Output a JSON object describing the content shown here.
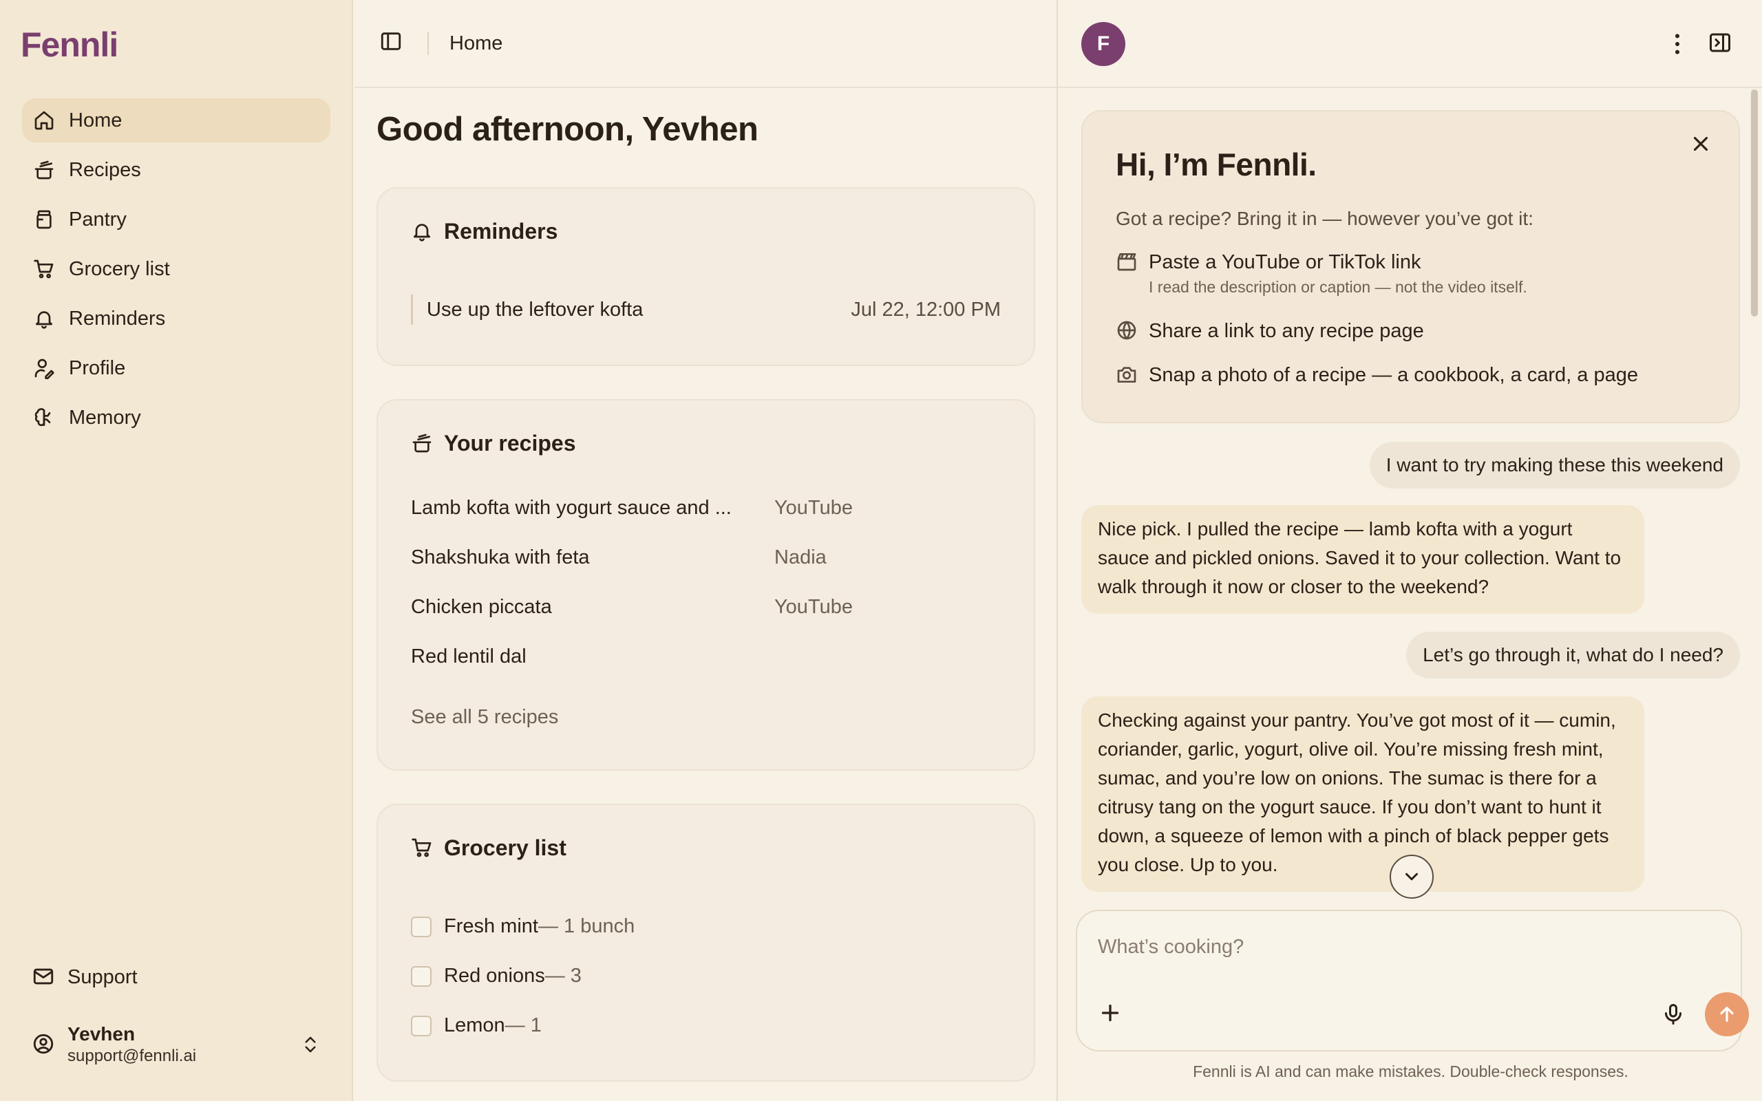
{
  "app": {
    "name": "Fennli"
  },
  "sidebar": {
    "items": [
      {
        "label": "Home",
        "icon": "home-icon"
      },
      {
        "label": "Recipes",
        "icon": "pot-icon"
      },
      {
        "label": "Pantry",
        "icon": "jar-icon"
      },
      {
        "label": "Grocery list",
        "icon": "cart-icon"
      },
      {
        "label": "Reminders",
        "icon": "bell-icon"
      },
      {
        "label": "Profile",
        "icon": "user-pen-icon"
      },
      {
        "label": "Memory",
        "icon": "brain-icon"
      }
    ],
    "support": "Support",
    "user": {
      "name": "Yevhen",
      "email": "support@fennli.ai"
    }
  },
  "main": {
    "breadcrumb": "Home",
    "greeting": "Good afternoon, Yevhen",
    "reminders": {
      "title": "Reminders",
      "items": [
        {
          "text": "Use up the leftover kofta",
          "when": "Jul 22, 12:00 PM"
        }
      ]
    },
    "recipes": {
      "title": "Your recipes",
      "items": [
        {
          "name": "Lamb kofta with yogurt sauce and ...",
          "source": "YouTube"
        },
        {
          "name": "Shakshuka with feta",
          "source": "Nadia"
        },
        {
          "name": "Chicken piccata",
          "source": "YouTube"
        },
        {
          "name": "Red lentil dal",
          "source": ""
        }
      ],
      "see_all": "See all 5 recipes"
    },
    "grocery": {
      "title": "Grocery list",
      "items": [
        {
          "name": "Fresh mint",
          "qty": " — 1 bunch"
        },
        {
          "name": "Red onions",
          "qty": " — 3"
        },
        {
          "name": "Lemon",
          "qty": " — 1"
        }
      ]
    }
  },
  "chat": {
    "avatar_letter": "F",
    "welcome": {
      "title": "Hi, I’m Fennli.",
      "intro": "Got a recipe? Bring it in — however you’ve got it:",
      "options": [
        {
          "text": "Paste a YouTube or TikTok link",
          "sub": "I read the description or caption — not the video itself.",
          "icon": "clapperboard-icon"
        },
        {
          "text": "Share a link to any recipe page",
          "sub": "",
          "icon": "globe-icon"
        },
        {
          "text": "Snap a photo of a recipe — a cookbook, a card, a page",
          "sub": "",
          "icon": "camera-icon"
        }
      ]
    },
    "messages": [
      {
        "role": "user",
        "text": "I want to try making these this weekend"
      },
      {
        "role": "assistant",
        "text": "Nice pick. I pulled the recipe — lamb kofta with a yogurt sauce and pickled onions. Saved it to your collection. Want to walk through it now or closer to the weekend?"
      },
      {
        "role": "user",
        "text": "Let’s go through it, what do I need?"
      },
      {
        "role": "assistant",
        "text": "Checking against your pantry. You’ve got most of it — cumin, coriander, garlic, yogurt, olive oil. You’re missing fresh mint, sumac, and you’re low on onions. The sumac is there for a citrusy tang on the yogurt sauce. If you don’t want to hunt it down, a squeeze of lemon with a pinch of black pepper gets you close. Up to you."
      }
    ],
    "composer": {
      "placeholder": "What’s cooking?"
    },
    "disclaimer": "Fennli is AI and can make mistakes. Double-check responses."
  },
  "colors": {
    "brand": "#7a3f6e",
    "send": "#ea9c6e",
    "sidebar_bg": "#f3e8d4",
    "active_nav": "#eddcbd"
  }
}
